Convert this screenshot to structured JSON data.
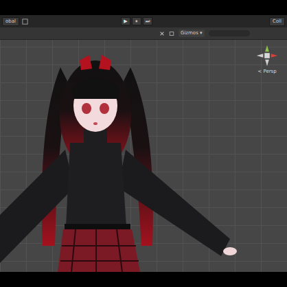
{
  "toolbar": {
    "left_label": "obal",
    "play_controls": [
      {
        "label": "▶",
        "selected": false
      },
      {
        "label": "⏸",
        "selected": false
      },
      {
        "label": "⏭",
        "selected": false
      }
    ],
    "right_label": "Coll"
  },
  "scene_toolbar": {
    "gizmos_label": "Gizmos"
  },
  "view_gizmo": {
    "projection_label": "< Persp"
  }
}
